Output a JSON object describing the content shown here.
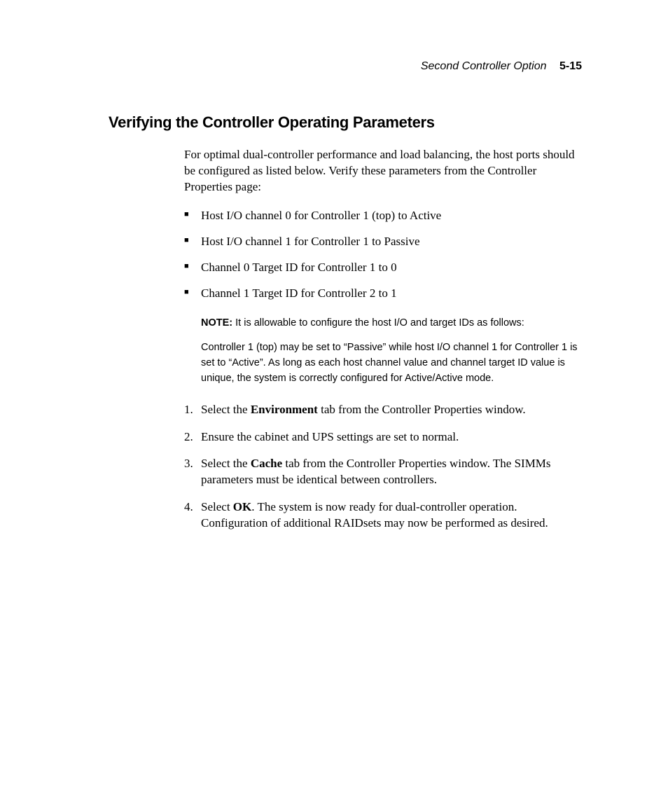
{
  "header": {
    "title": "Second Controller Option",
    "page": "5-15"
  },
  "section": {
    "title": "Verifying the Controller Operating Parameters",
    "intro": "For optimal dual-controller performance and load balancing, the host ports should be configured as listed below. Verify these parameters from the Controller Properties page:",
    "bullets": [
      "Host I/O channel 0 for Controller 1 (top) to Active",
      "Host I/O channel 1 for Controller 1 to Passive",
      "Channel 0 Target ID for Controller 1 to 0",
      "Channel 1 Target ID for Controller 2 to 1"
    ],
    "note": {
      "label": "NOTE:",
      "line1_rest": "  It is allowable to configure the host I/O and target IDs as follows:",
      "line2_part1": "Controller 1 (top) may be set to ",
      "line2_quote1": "“Passive”",
      "line2_part2": " while host I/O channel 1 for Controller 1 is set to ",
      "line2_quote2": "“Active”",
      "line2_part3": ". As long as each host channel value and channel target ID value is unique, the system is correctly configured for Active/Active mode."
    },
    "steps": {
      "s1_a": "Select the ",
      "s1_b": "Environment",
      "s1_c": " tab from the Controller Properties window.",
      "s2": "Ensure the cabinet and UPS settings are set to normal.",
      "s3_a": "Select the ",
      "s3_b": "Cache",
      "s3_c": " tab from the Controller Properties window. The SIMMs parameters must be identical between controllers.",
      "s4_a": "Select ",
      "s4_b": "OK",
      "s4_c": ". The system is now ready for dual-controller operation. Configuration of additional RAIDsets may now be performed as desired."
    }
  }
}
